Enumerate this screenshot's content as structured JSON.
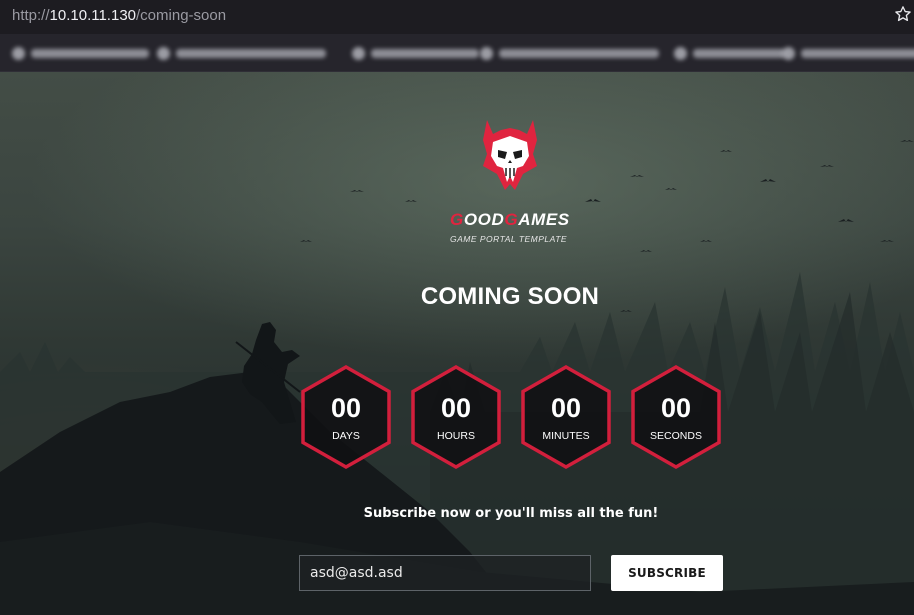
{
  "browser": {
    "url_prefix": "http://",
    "url_host": "10.10.11.130",
    "url_path": "/coming-soon",
    "bookmark_star_icon": "star-icon"
  },
  "brand": {
    "logo_icon": "skull-emblem-icon",
    "name_letter_1": "G",
    "name_part_1": "OOD",
    "name_letter_2": "G",
    "name_part_2": "AMES",
    "tagline": "GAME PORTAL TEMPLATE",
    "accent_color": "#e0243f"
  },
  "main": {
    "title": "COMING SOON",
    "countdown": [
      {
        "value": "00",
        "label": "DAYS"
      },
      {
        "value": "00",
        "label": "HOURS"
      },
      {
        "value": "00",
        "label": "MINUTES"
      },
      {
        "value": "00",
        "label": "SECONDS"
      }
    ],
    "subscribe_prompt": "Subscribe now or you'll miss all the fun!",
    "email_value": "asd@asd.asd",
    "subscribe_button": "SUBSCRIBE"
  }
}
